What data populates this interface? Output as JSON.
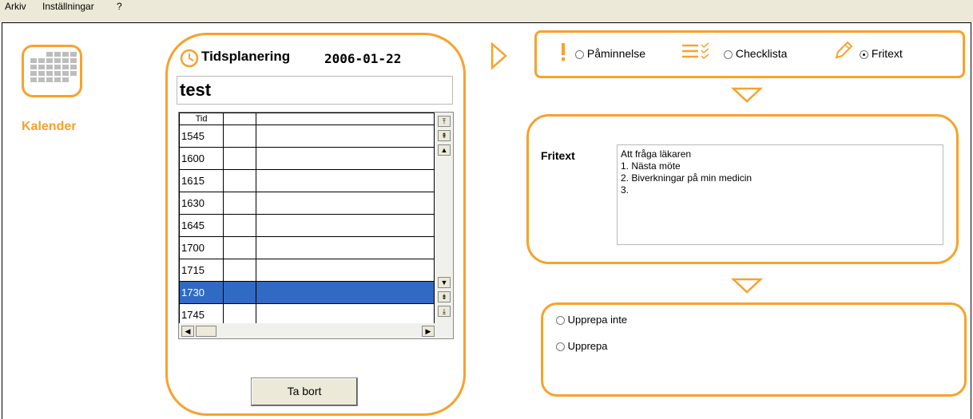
{
  "menu": {
    "items": [
      "Arkiv",
      "Inställningar",
      "?"
    ]
  },
  "nav": {
    "calendar_label": "Kalender"
  },
  "planner": {
    "title": "Tidsplanering",
    "date": "2006-01-22",
    "name_value": "test",
    "column_header": "Tid",
    "rows": [
      "1545",
      "1600",
      "1615",
      "1630",
      "1645",
      "1700",
      "1715",
      "1730",
      "1745"
    ],
    "selected_row": "1730",
    "delete_label": "Ta bort"
  },
  "type": {
    "options": [
      {
        "label": "Påminnelse",
        "selected": false
      },
      {
        "label": "Checklista",
        "selected": false
      },
      {
        "label": "Fritext",
        "selected": true
      }
    ]
  },
  "fritext": {
    "label": "Fritext",
    "text": "Att fråga läkaren\n1. Nästa möte\n2. Biverkningar på min medicin\n3."
  },
  "repeat": {
    "options": [
      {
        "label": "Upprepa inte",
        "selected": false
      },
      {
        "label": "Upprepa",
        "selected": false
      }
    ]
  },
  "colors": {
    "accent": "#f7a22c",
    "selection": "#316ac5"
  }
}
